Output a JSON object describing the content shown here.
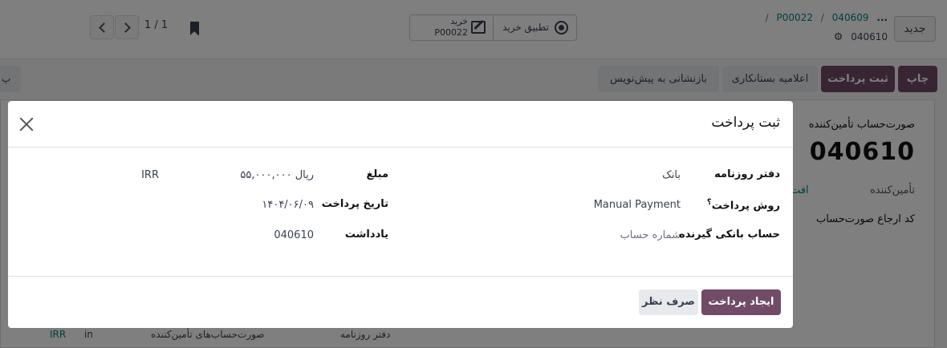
{
  "control_panel": {
    "new_button": "جدید",
    "breadcrumb": {
      "ellipsis": "...",
      "parent1": "P00022",
      "parent2": "040609",
      "current": "040610",
      "separator": "/"
    },
    "smart_buttons": {
      "purchase_apply": "تطبیق خرید",
      "purchase_title": "خرید",
      "purchase_ref": "P00022"
    },
    "pager": "1 / 1"
  },
  "actions": {
    "print": "چاپ",
    "register_payment": "ثبت پرداخت",
    "credit_note": "اعلامیه بستانکاری",
    "reset_to_draft": "بازنشانی به پیش‌نویس",
    "edge_button": "پ"
  },
  "background_form": {
    "title": "صورت‌حساب تأمین‌کننده",
    "number": "040610",
    "vendor_label": "تأمین‌کننده",
    "vendor_link": "افت",
    "bill_reference_label": "کد ارجاع صورت‌حساب",
    "line_irr": "IRR",
    "line_in": "in",
    "line_vendor_bills": "صورت‌حساب‌های تأمین‌کننده",
    "line_journal": "دفتر روزنامه"
  },
  "dialog": {
    "title": "ثبت پرداخت",
    "fields": {
      "journal_label": "دفتر روزنامه",
      "journal_value": "بانک",
      "payment_method_label": "روش پرداخت",
      "payment_method_help": "؟",
      "payment_method_value": "Manual Payment",
      "recipient_bank_label": "حساب بانکی گیرنده",
      "recipient_bank_placeholder": "شماره حساب",
      "amount_label": "مبلغ",
      "amount_value": "۵۵,۰۰۰,۰۰۰ ریال",
      "currency_value": "IRR",
      "payment_date_label": "تاریخ پرداخت",
      "payment_date_value": "۱۴۰۴/۰۶/۰۹",
      "memo_label": "یادداشت",
      "memo_value": "040610"
    },
    "buttons": {
      "create_payment": "ایجاد پرداخت",
      "cancel": "صرف نظر"
    }
  },
  "colors": {
    "primary": "#714b67",
    "link": "#017e84",
    "secondary_bg": "#e7e9ed",
    "overlay": "rgba(0,0,0,0.5)"
  }
}
